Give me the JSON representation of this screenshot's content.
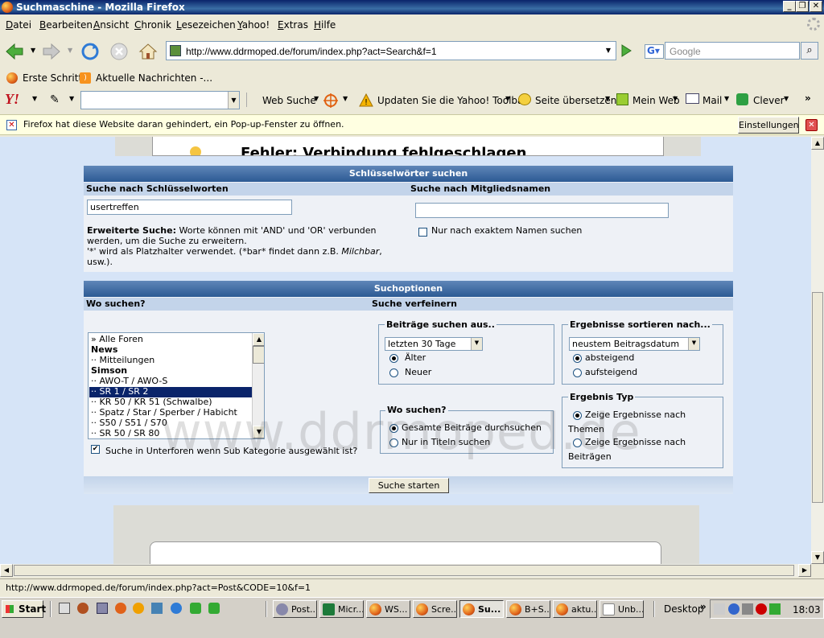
{
  "window": {
    "title": "Suchmaschine - Mozilla Firefox"
  },
  "menu": [
    "Datei",
    "Bearbeiten",
    "Ansicht",
    "Chronik",
    "Lesezeichen",
    "Yahoo!",
    "Extras",
    "Hilfe"
  ],
  "nav": {
    "url": "http://www.ddrmoped.de/forum/index.php?act=Search&f=1",
    "search_placeholder": "Google"
  },
  "bookmarks": [
    "Erste Schritte",
    "Aktuelle Nachrichten -..."
  ],
  "yahoo_toolbar": {
    "web_search": "Web Suche",
    "update": "Updaten Sie die Yahoo! Toolbar",
    "translate": "Seite übersetzen",
    "myweb": "Mein Web",
    "mail": "Mail",
    "clever": "Clever"
  },
  "popup": {
    "message": "Firefox hat diese Website daran gehindert, ein Pop-up-Fenster zu öffnen.",
    "settings_button": "Einstellungen"
  },
  "page": {
    "error_heading": "Fehler: Verbindung fehlgeschlagen",
    "keywords": {
      "header": "Schlüsselwörter suchen",
      "by_keyword_label": "Suche nach Schlüsselworten",
      "by_member_label": "Suche nach Mitgliedsnamen",
      "keyword_value": "usertreffen",
      "member_value": "",
      "exact_name_label": "Nur nach exaktem Namen suchen",
      "advanced_title": "Erweiterte Suche:",
      "advanced_line1": "Worte können mit 'AND' und 'OR' verbunden",
      "advanced_line2": "werden, um die Suche zu erweitern.",
      "advanced_line3": "'*' wird als Platzhalter verwendet. (*bar* findet dann z.B. ",
      "advanced_italic": "Milchbar",
      "advanced_line3_end": ",",
      "advanced_line4": "usw.)."
    },
    "options": {
      "header": "Suchoptionen",
      "where_label": "Wo suchen?",
      "refine_label": "Suche verfeinern",
      "forums": [
        {
          "label": "» Alle Foren",
          "bold": false
        },
        {
          "label": "News",
          "bold": true
        },
        {
          "label": "·· Mitteilungen",
          "bold": false
        },
        {
          "label": "Simson",
          "bold": true
        },
        {
          "label": "·· AWO-T / AWO-S",
          "bold": false
        },
        {
          "label": "·· SR 1 / SR 2",
          "bold": false
        },
        {
          "label": "·· KR 50 / KR 51 (Schwalbe)",
          "bold": false
        },
        {
          "label": "·· Spatz / Star / Sperber / Habicht",
          "bold": false
        },
        {
          "label": "·· S50 / S51 / S70",
          "bold": false
        },
        {
          "label": "·· SR 50 / SR 80",
          "bold": false
        }
      ],
      "subforum_label": "Suche in Unterforen wenn Sub Kategorie ausgewählt ist?",
      "posts_from": {
        "legend": "Beiträge suchen aus..",
        "select_value": "letzten 30 Tage",
        "older": "Älter",
        "newer": "Neuer"
      },
      "sort": {
        "legend": "Ergebnisse sortieren nach...",
        "select_value": "neustem Beitragsdatum",
        "desc": "absteigend",
        "asc": "aufsteigend"
      },
      "where": {
        "legend": "Wo suchen?",
        "full": "Gesamte Beiträge durchsuchen",
        "titles": "Nur in Titeln suchen"
      },
      "result_type": {
        "legend": "Ergebnis Typ",
        "topics_1": "Zeige Ergebnisse nach",
        "topics_2": "Themen",
        "posts_1": "Zeige Ergebnisse nach",
        "posts_2": "Beiträgen"
      },
      "submit": "Suche starten"
    },
    "watermark": "www.ddrmoped.de"
  },
  "status": {
    "text": "http://www.ddrmoped.de/forum/index.php?act=Post&CODE=10&f=1"
  },
  "taskbar": {
    "start": "Start",
    "tasks": [
      "Post...",
      "Micr...",
      "WS...",
      "Scre...",
      "Su...",
      "B+S...",
      "aktu...",
      "Unb..."
    ],
    "desktop": "Desktop",
    "clock": "18:03"
  }
}
